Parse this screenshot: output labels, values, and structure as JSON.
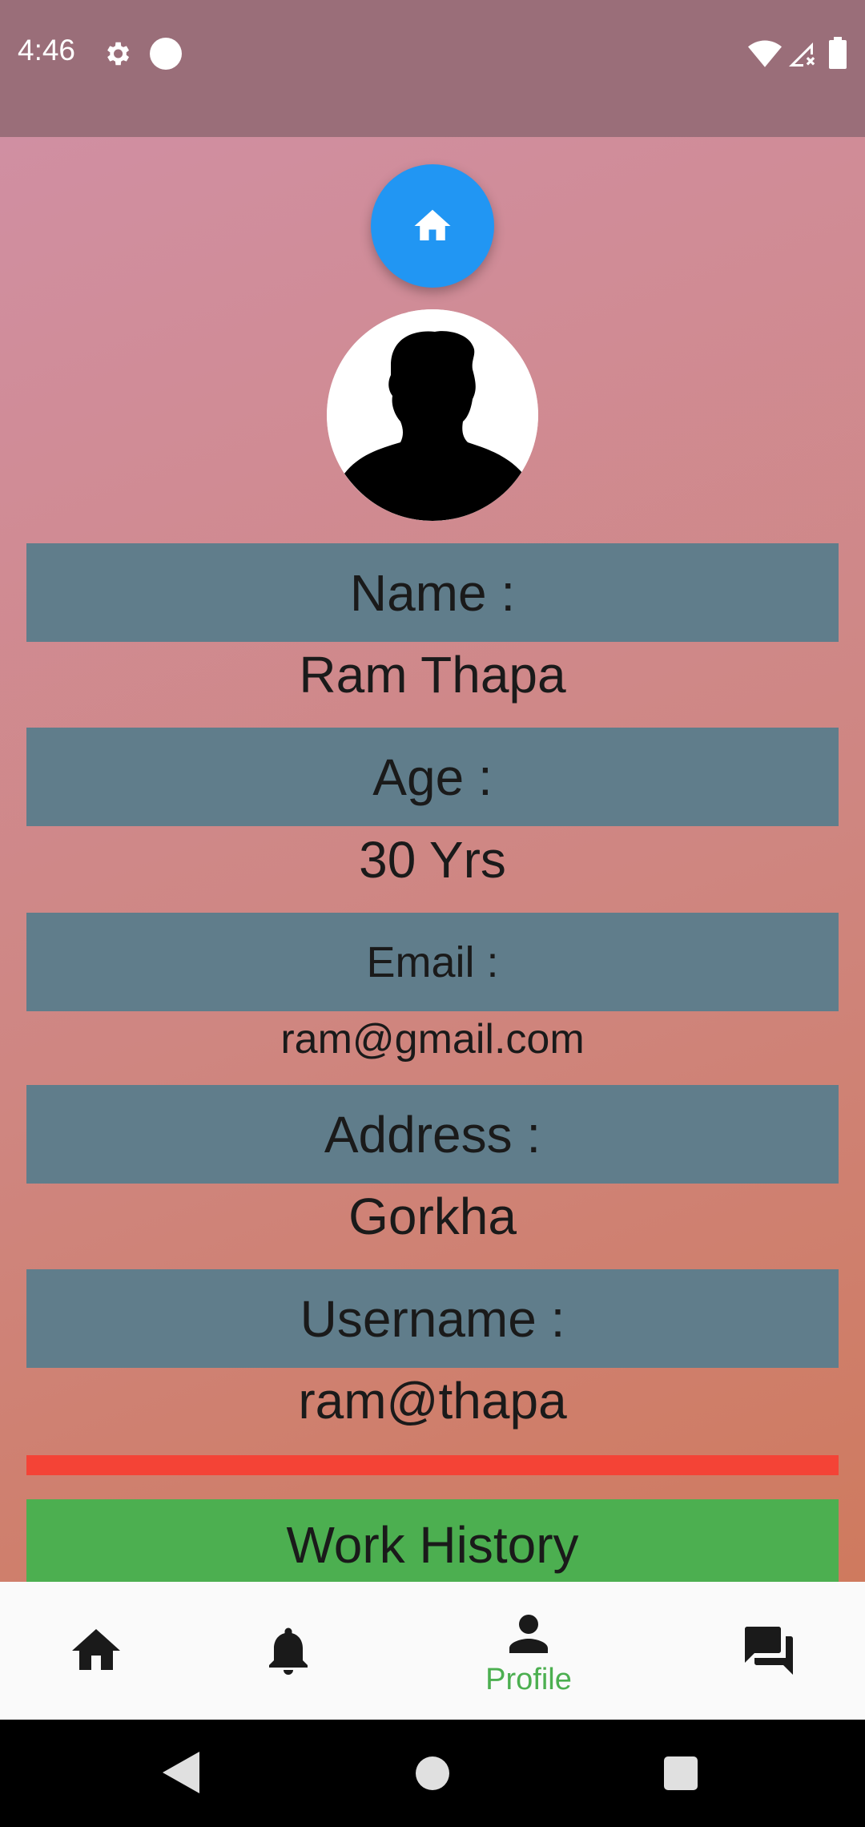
{
  "status_bar": {
    "time": "4:46",
    "icons": [
      "gear-icon",
      "circle-dot-icon",
      "wifi-icon",
      "signal-icon",
      "battery-icon"
    ]
  },
  "profile": {
    "fields": [
      {
        "label": "Name :",
        "value": "Ram Thapa"
      },
      {
        "label": "Age :",
        "value": "30 Yrs"
      },
      {
        "label": "Email :",
        "value": "ram@gmail.com"
      },
      {
        "label": "Address :",
        "value": "Gorkha"
      },
      {
        "label": "Username :",
        "value": "ram@thapa"
      }
    ],
    "work_history_label": "Work History"
  },
  "bottom_nav": {
    "items": [
      {
        "icon": "home-icon"
      },
      {
        "icon": "bell-icon"
      },
      {
        "icon": "person-icon",
        "label": "Profile",
        "active": true
      },
      {
        "icon": "chat-icon"
      }
    ]
  },
  "colors": {
    "fab": "#2196f3",
    "label_box": "#607d8b",
    "divider": "#f44336",
    "work_history": "#4caf50",
    "active_nav": "#4caf50"
  }
}
